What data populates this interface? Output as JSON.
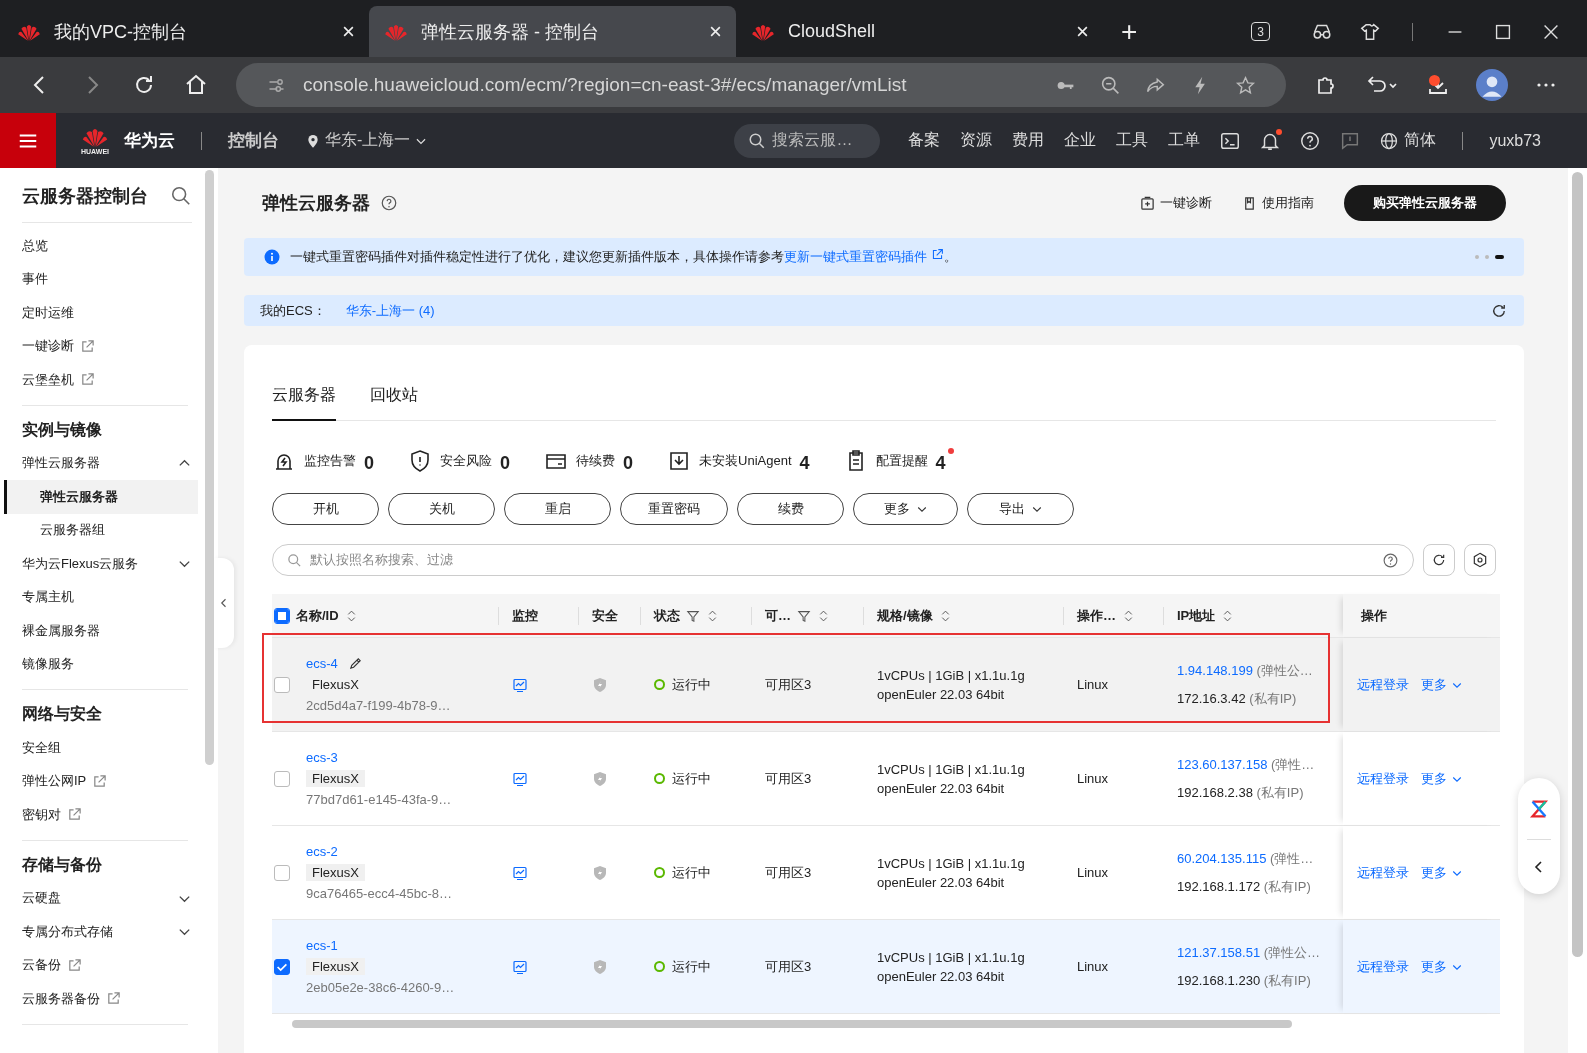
{
  "browser": {
    "tabs": [
      {
        "title": "我的VPC-控制台",
        "selected": false
      },
      {
        "title": "弹性云服务器 - 控制台",
        "selected": true
      },
      {
        "title": "CloudShell",
        "selected": false
      }
    ],
    "new_tab": "+",
    "tab_count": "3",
    "url": "console.huaweicloud.com/ecm/?region=cn-east-3#/ecs/manager/vmList"
  },
  "topnav": {
    "brand": "华为云",
    "brand_small": "HUAWEI",
    "console": "控制台",
    "region": "华东-上海一",
    "search_placeholder": "搜索云服…",
    "links": [
      "备案",
      "资源",
      "费用",
      "企业",
      "工具",
      "工单"
    ],
    "notifications_unread": true,
    "language": "简体",
    "user": "yuxb73"
  },
  "sidebar": {
    "title": "云服务器控制台",
    "groups": [
      {
        "items": [
          {
            "label": "总览",
            "external": false,
            "selected": false
          },
          {
            "label": "事件",
            "external": false,
            "selected": false
          },
          {
            "label": "定时运维",
            "external": false,
            "selected": false
          },
          {
            "label": "一键诊断",
            "external": true,
            "selected": false
          },
          {
            "label": "云堡垒机",
            "external": true,
            "selected": false
          }
        ]
      },
      {
        "heading": "实例与镜像",
        "items": [
          {
            "label": "弹性云服务器",
            "external": false,
            "selected": false,
            "expanded": true,
            "children": [
              {
                "label": "弹性云服务器",
                "external": false,
                "selected": true
              },
              {
                "label": "云服务器组",
                "external": false,
                "selected": false
              }
            ]
          },
          {
            "label": "华为云Flexus云服务",
            "external": false,
            "selected": false,
            "expanded": false
          },
          {
            "label": "专属主机",
            "external": false,
            "selected": false
          },
          {
            "label": "裸金属服务器",
            "external": false,
            "selected": false
          },
          {
            "label": "镜像服务",
            "external": false,
            "selected": false
          }
        ]
      },
      {
        "heading": "网络与安全",
        "items": [
          {
            "label": "安全组",
            "external": false,
            "selected": false
          },
          {
            "label": "弹性公网IP",
            "external": true,
            "selected": false
          },
          {
            "label": "密钥对",
            "external": true,
            "selected": false
          }
        ]
      },
      {
        "heading": "存储与备份",
        "items": [
          {
            "label": "云硬盘",
            "external": false,
            "selected": false,
            "expanded": false
          },
          {
            "label": "专属分布式存储",
            "external": false,
            "selected": false,
            "expanded": false
          },
          {
            "label": "云备份",
            "external": true,
            "selected": false
          },
          {
            "label": "云服务器备份",
            "external": true,
            "selected": false
          }
        ]
      }
    ]
  },
  "page": {
    "title": "弹性云服务器",
    "actions": [
      "一键诊断",
      "使用指南"
    ],
    "buy_button": "购买弹性云服务器"
  },
  "notice": {
    "text": "一键式重置密码插件对插件稳定性进行了优化，建议您更新插件版本，具体操作请参考",
    "link": "更新一键式重置密码插件",
    "end": "。"
  },
  "ecs_bar": {
    "label": "我的ECS：",
    "region": "华东-上海一 (4)"
  },
  "tabs": [
    {
      "label": "云服务器",
      "selected": true
    },
    {
      "label": "回收站",
      "selected": false
    }
  ],
  "stats": [
    {
      "label": "监控告警",
      "count": "0",
      "alert": false
    },
    {
      "label": "安全风险",
      "count": "0",
      "alert": false
    },
    {
      "label": "待续费",
      "count": "0",
      "alert": false
    },
    {
      "label": "未安装UniAgent",
      "count": "4",
      "alert": false
    },
    {
      "label": "配置提醒",
      "count": "4",
      "alert": true
    }
  ],
  "buttons": [
    {
      "label": "开机",
      "dropdown": false
    },
    {
      "label": "关机",
      "dropdown": false
    },
    {
      "label": "重启",
      "dropdown": false
    },
    {
      "label": "重置密码",
      "dropdown": false
    },
    {
      "label": "续费",
      "dropdown": false
    },
    {
      "label": "更多",
      "dropdown": true
    },
    {
      "label": "导出",
      "dropdown": true
    }
  ],
  "filter": {
    "placeholder": "默认按照名称搜索、过滤"
  },
  "table": {
    "select_all_indeterminate": true,
    "columns": [
      {
        "label": "名称/ID",
        "filter": false,
        "sort": true
      },
      {
        "label": "监控",
        "filter": false,
        "sort": false
      },
      {
        "label": "安全",
        "filter": false,
        "sort": false
      },
      {
        "label": "状态",
        "filter": true,
        "sort": true
      },
      {
        "label": "可…",
        "filter": true,
        "sort": true
      },
      {
        "label": "规格/镜像",
        "filter": false,
        "sort": true
      },
      {
        "label": "操作…",
        "filter": false,
        "sort": true
      },
      {
        "label": "IP地址",
        "filter": false,
        "sort": true
      },
      {
        "label": "操作",
        "filter": false,
        "sort": false
      }
    ],
    "rows": [
      {
        "name": "ecs-4",
        "tag": "FlexusX",
        "id": "2cd5d4a7-f199-4b78-9…",
        "status": "运行中",
        "zone": "可用区3",
        "spec": "1vCPUs | 1GiB | x1.1u.1g",
        "image": "openEuler 22.03 64bit",
        "os": "Linux",
        "public_ip": "1.94.148.199",
        "public_note": "(弹性公…",
        "private_ip": "172.16.3.42",
        "private_note": "(私有IP)",
        "actions": [
          "远程登录",
          "更多"
        ],
        "selected": false,
        "hovered": true,
        "flagged": true
      },
      {
        "name": "ecs-3",
        "tag": "FlexusX",
        "id": "77bd7d61-e145-43fa-9…",
        "status": "运行中",
        "zone": "可用区3",
        "spec": "1vCPUs | 1GiB | x1.1u.1g",
        "image": "openEuler 22.03 64bit",
        "os": "Linux",
        "public_ip": "123.60.137.158",
        "public_note": "(弹性…",
        "private_ip": "192.168.2.38",
        "private_note": "(私有IP)",
        "actions": [
          "远程登录",
          "更多"
        ],
        "selected": false,
        "hovered": false,
        "flagged": false
      },
      {
        "name": "ecs-2",
        "tag": "FlexusX",
        "id": "9ca76465-ecc4-45bc-8…",
        "status": "运行中",
        "zone": "可用区3",
        "spec": "1vCPUs | 1GiB | x1.1u.1g",
        "image": "openEuler 22.03 64bit",
        "os": "Linux",
        "public_ip": "60.204.135.115",
        "public_note": "(弹性…",
        "private_ip": "192.168.1.172",
        "private_note": "(私有IP)",
        "actions": [
          "远程登录",
          "更多"
        ],
        "selected": false,
        "hovered": false,
        "flagged": false
      },
      {
        "name": "ecs-1",
        "tag": "FlexusX",
        "id": "2eb05e2e-38c6-4260-9…",
        "status": "运行中",
        "zone": "可用区3",
        "spec": "1vCPUs | 1GiB | x1.1u.1g",
        "image": "openEuler 22.03 64bit",
        "os": "Linux",
        "public_ip": "121.37.158.51",
        "public_note": "(弹性公…",
        "private_ip": "192.168.1.230",
        "private_note": "(私有IP)",
        "actions": [
          "远程登录",
          "更多"
        ],
        "selected": true,
        "hovered": false,
        "flagged": false
      }
    ]
  }
}
